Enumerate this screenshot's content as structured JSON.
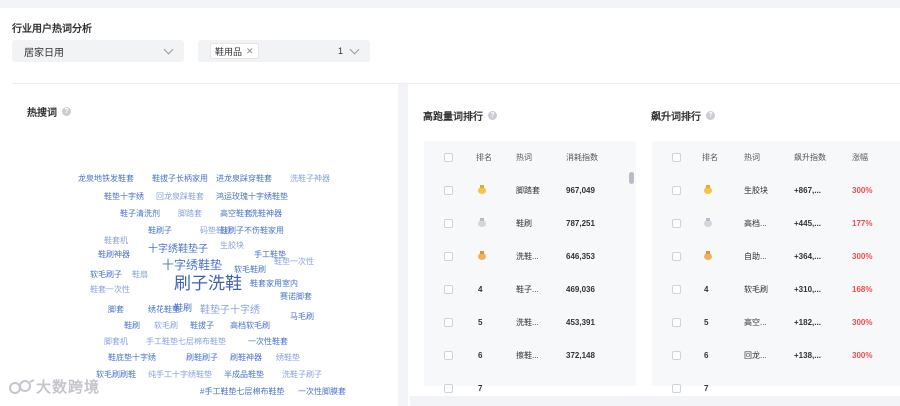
{
  "section_title": "行业用户热词分析",
  "filters": {
    "category": "居家日用",
    "tag": "鞋用品",
    "count": "1"
  },
  "hot_search": {
    "title": "热搜词",
    "words": [
      {
        "text": "龙泉地铁发鞋套",
        "color": "#4a74c9",
        "size": 8
      },
      {
        "text": "鞋拔子长柄家用",
        "color": "#4a74c9",
        "size": 8
      },
      {
        "text": "进龙泉踩穿鞋套",
        "color": "#4a74c9",
        "size": 8
      },
      {
        "text": "洗鞋子神器",
        "color": "#8ba3dc",
        "size": 8
      },
      {
        "text": "鞋垫十字绣",
        "color": "#4a74c9",
        "size": 8
      },
      {
        "text": "回龙泉踩鞋套",
        "color": "#8ba3dc",
        "size": 8
      },
      {
        "text": "鸿运玫瑰十字绣鞋垫",
        "color": "#4a74c9",
        "size": 8
      },
      {
        "text": "鞋子清洗剂",
        "color": "#4a74c9",
        "size": 8
      },
      {
        "text": "脚踏套",
        "color": "#8ba3dc",
        "size": 8
      },
      {
        "text": "高空鞋套",
        "color": "#4a74c9",
        "size": 8
      },
      {
        "text": "洗鞋神器",
        "color": "#4a74c9",
        "size": 8
      },
      {
        "text": "鞋刷子",
        "color": "#4a74c9",
        "size": 8
      },
      {
        "text": "鞋套机",
        "color": "#8ba3dc",
        "size": 8
      },
      {
        "text": "码垫鞋底",
        "color": "#8ba3dc",
        "size": 8
      },
      {
        "text": "鞋刷子不伤鞋家用",
        "color": "#4a74c9",
        "size": 8
      },
      {
        "text": "十字绣鞋垫子",
        "color": "#4a74c9",
        "size": 10
      },
      {
        "text": "鞋刷神器",
        "color": "#4a74c9",
        "size": 8
      },
      {
        "text": "生胶块",
        "color": "#8ba3dc",
        "size": 8
      },
      {
        "text": "手工鞋垫",
        "color": "#4a74c9",
        "size": 8
      },
      {
        "text": "十字绣鞋垫",
        "color": "#4a74c9",
        "size": 12
      },
      {
        "text": "鞋垫一次性",
        "color": "#8ba3dc",
        "size": 8
      },
      {
        "text": "软毛鞋刷",
        "color": "#4a74c9",
        "size": 8
      },
      {
        "text": "软毛刷子",
        "color": "#4a74c9",
        "size": 8
      },
      {
        "text": "鞋扇",
        "color": "#8ba3dc",
        "size": 8
      },
      {
        "text": "刷子洗鞋",
        "color": "#3e5fb4",
        "size": 17
      },
      {
        "text": "鞋套家用室内",
        "color": "#4a74c9",
        "size": 8
      },
      {
        "text": "鞋套一次性",
        "color": "#8ba3dc",
        "size": 8
      },
      {
        "text": "赛诺脚套",
        "color": "#4a74c9",
        "size": 8
      },
      {
        "text": "脚套",
        "color": "#4a74c9",
        "size": 8
      },
      {
        "text": "绣花鞋垫",
        "color": "#4a74c9",
        "size": 8
      },
      {
        "text": "鞋刷",
        "color": "#4a74c9",
        "size": 9
      },
      {
        "text": "鞋垫子十字绣",
        "color": "#8ba3dc",
        "size": 10
      },
      {
        "text": "马毛刷",
        "color": "#4a74c9",
        "size": 8
      },
      {
        "text": "鞋刷",
        "color": "#4a74c9",
        "size": 8
      },
      {
        "text": "软毛刷",
        "color": "#8ba3dc",
        "size": 8
      },
      {
        "text": "鞋拔子",
        "color": "#4a74c9",
        "size": 8
      },
      {
        "text": "高档软毛刷",
        "color": "#4a74c9",
        "size": 8
      },
      {
        "text": "脚套机",
        "color": "#8ba3dc",
        "size": 8
      },
      {
        "text": "手工鞋垫七层棉布鞋垫",
        "color": "#8ba3dc",
        "size": 8
      },
      {
        "text": "一次性鞋套",
        "color": "#4a74c9",
        "size": 8
      },
      {
        "text": "鞋底垫十字绣",
        "color": "#4a74c9",
        "size": 8
      },
      {
        "text": "刷鞋刷子",
        "color": "#4a74c9",
        "size": 8
      },
      {
        "text": "刷鞋神器",
        "color": "#4a74c9",
        "size": 8
      },
      {
        "text": "绣鞋垫",
        "color": "#8ba3dc",
        "size": 8
      },
      {
        "text": "软毛刷刷鞋",
        "color": "#4a74c9",
        "size": 8
      },
      {
        "text": "纯手工十字绣鞋垫",
        "color": "#8ba3dc",
        "size": 8
      },
      {
        "text": "半成品鞋垫",
        "color": "#4a74c9",
        "size": 8
      },
      {
        "text": "洗鞋子刷子",
        "color": "#8ba3dc",
        "size": 8
      },
      {
        "text": "#手工鞋垫七层棉布鞋垫",
        "color": "#4a74c9",
        "size": 8
      },
      {
        "text": "一次性脚膜套",
        "color": "#4a74c9",
        "size": 8
      }
    ]
  },
  "high_rank": {
    "title": "高跑量词排行",
    "headers": [
      "排名",
      "热词",
      "消耗指数"
    ],
    "rows": [
      {
        "rank": "1",
        "medal": "gold",
        "word": "脚踏套",
        "value": "967,049"
      },
      {
        "rank": "2",
        "medal": "silver",
        "word": "鞋刷",
        "value": "787,251"
      },
      {
        "rank": "3",
        "medal": "bronze",
        "word": "洗鞋...",
        "value": "646,353"
      },
      {
        "rank": "4",
        "medal": "",
        "word": "鞋子...",
        "value": "469,036"
      },
      {
        "rank": "5",
        "medal": "",
        "word": "洗鞋...",
        "value": "453,391"
      },
      {
        "rank": "6",
        "medal": "",
        "word": "擦鞋...",
        "value": "372,148"
      },
      {
        "rank": "7",
        "medal": "",
        "word": "",
        "value": ""
      }
    ]
  },
  "rising_rank": {
    "title": "飙升词排行",
    "headers": [
      "排名",
      "热词",
      "飙升指数",
      "涨幅"
    ],
    "rows": [
      {
        "rank": "1",
        "medal": "gold",
        "word": "生胶块",
        "value": "+867,...",
        "growth": "300%"
      },
      {
        "rank": "2",
        "medal": "silver",
        "word": "高档...",
        "value": "+445,...",
        "growth": "177%"
      },
      {
        "rank": "3",
        "medal": "bronze",
        "word": "自助...",
        "value": "+364,...",
        "growth": "300%"
      },
      {
        "rank": "4",
        "medal": "",
        "word": "软毛刷",
        "value": "+310,...",
        "growth": "168%"
      },
      {
        "rank": "5",
        "medal": "",
        "word": "高空...",
        "value": "+182,...",
        "growth": "300%"
      },
      {
        "rank": "6",
        "medal": "",
        "word": "回龙...",
        "value": "+138,...",
        "growth": "300%"
      },
      {
        "rank": "7",
        "medal": "",
        "word": "",
        "value": "",
        "growth": ""
      }
    ]
  },
  "watermark": "大数跨境"
}
